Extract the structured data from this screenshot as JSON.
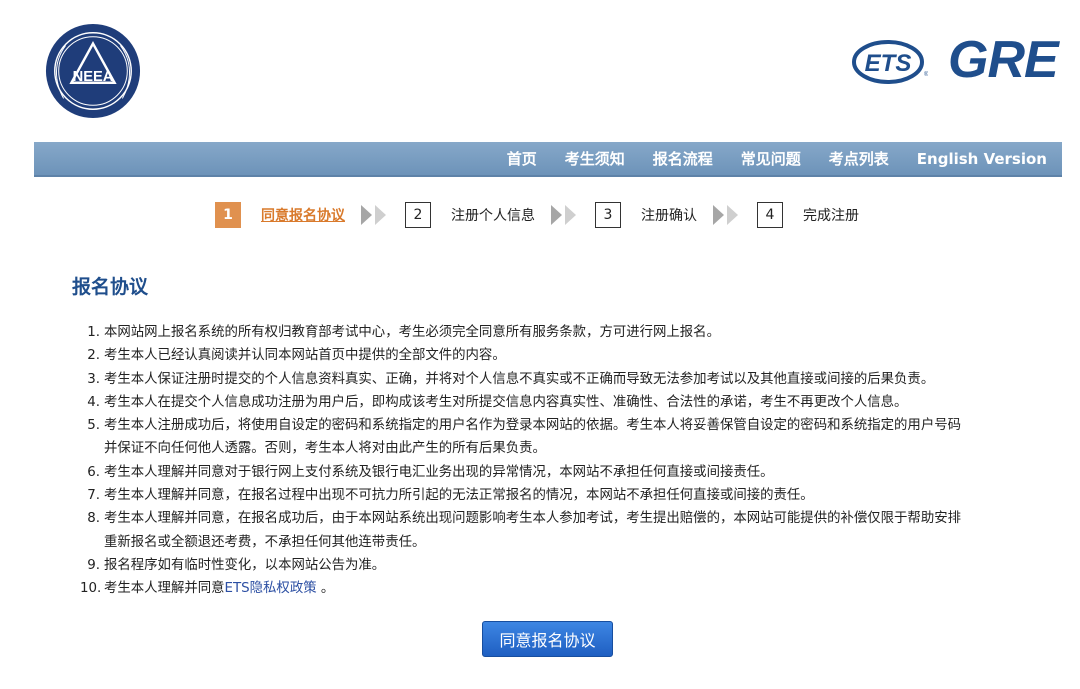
{
  "header": {
    "neea_logo_text": "NEEA",
    "ets_logo_text": "ETS",
    "gre_logo_text": "GRE"
  },
  "nav": {
    "items": [
      "首页",
      "考生须知",
      "报名流程",
      "常见问题",
      "考点列表",
      "English Version"
    ]
  },
  "steps": [
    {
      "num": "1",
      "label": "同意报名协议",
      "active": true
    },
    {
      "num": "2",
      "label": "注册个人信息",
      "active": false
    },
    {
      "num": "3",
      "label": "注册确认",
      "active": false
    },
    {
      "num": "4",
      "label": "完成注册",
      "active": false
    }
  ],
  "title": "报名协议",
  "terms": [
    {
      "num": "1.",
      "lines": [
        "本网站网上报名系统的所有权归教育部考试中心，考生必须完全同意所有服务条款，方可进行网上报名。"
      ]
    },
    {
      "num": "2.",
      "lines": [
        "考生本人已经认真阅读并认同本网站首页中提供的全部文件的内容。"
      ]
    },
    {
      "num": "3.",
      "lines": [
        "考生本人保证注册时提交的个人信息资料真实、正确，并将对个人信息不真实或不正确而导致无法参加考试以及其他直接或间接的后果负责。"
      ]
    },
    {
      "num": "4.",
      "lines": [
        "考生本人在提交个人信息成功注册为用户后，即构成该考生对所提交信息内容真实性、准确性、合法性的承诺，考生不再更改个人信息。"
      ]
    },
    {
      "num": "5.",
      "lines": [
        "考生本人注册成功后，将使用自设定的密码和系统指定的用户名作为登录本网站的依据。考生本人将妥善保管自设定的密码和系统指定的用户号码",
        "并保证不向任何他人透露。否则，考生本人将对由此产生的所有后果负责。"
      ]
    },
    {
      "num": "6.",
      "lines": [
        "考生本人理解并同意对于银行网上支付系统及银行电汇业务出现的异常情况，本网站不承担任何直接或间接责任。"
      ]
    },
    {
      "num": "7.",
      "lines": [
        "考生本人理解并同意，在报名过程中出现不可抗力所引起的无法正常报名的情况，本网站不承担任何直接或间接的责任。"
      ]
    },
    {
      "num": "8.",
      "lines": [
        "考生本人理解并同意，在报名成功后，由于本网站系统出现问题影响考生本人参加考试，考生提出赔偿的，本网站可能提供的补偿仅限于帮助安排",
        "重新报名或全额退还考费，不承担任何其他连带责任。"
      ]
    },
    {
      "num": "9.",
      "lines": [
        "报名程序如有临时性变化，以本网站公告为准。"
      ]
    }
  ],
  "term10": {
    "num": "10.",
    "prefix": "考生本人理解并同意",
    "link": "ETS隐私权政策",
    "suffix": " 。"
  },
  "agree_button": "同意报名协议",
  "colors": {
    "nav_bg": "#7a9ec3",
    "accent_orange": "#e0914f",
    "title_blue": "#1f4e8c",
    "button_blue": "#2a6fd2"
  }
}
